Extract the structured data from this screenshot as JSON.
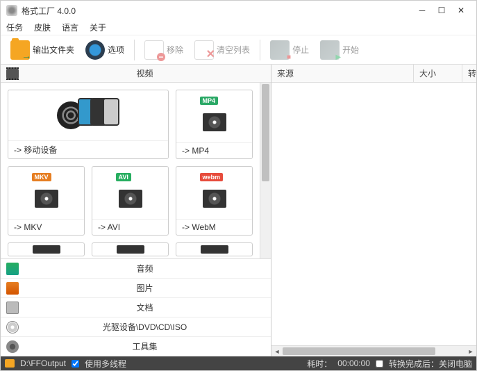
{
  "window": {
    "title": "格式工厂 4.0.0"
  },
  "menu": {
    "tasks": "任务",
    "skin": "皮肤",
    "language": "语言",
    "about": "关于"
  },
  "toolbar": {
    "output_folder": "输出文件夹",
    "options": "选项",
    "remove": "移除",
    "clear_list": "清空列表",
    "stop": "停止",
    "start": "开始"
  },
  "categories": {
    "video": "视频",
    "audio": "音频",
    "picture": "图片",
    "document": "文档",
    "disc": "光驱设备\\DVD\\CD\\ISO",
    "toolkit": "工具集"
  },
  "tiles": {
    "mobile": "-> 移动设备",
    "mp4": "-> MP4",
    "mkv": "-> MKV",
    "avi": "-> AVI",
    "webm": "-> WebM"
  },
  "badges": {
    "mp4": "MP4",
    "mkv": "MKV",
    "avi": "AVI",
    "webm": "webm"
  },
  "list": {
    "source": "来源",
    "size": "大小",
    "status": "转"
  },
  "status": {
    "output_path": "D:\\FFOutput",
    "multithread": "使用多线程",
    "elapsed_label": "耗时：",
    "elapsed_value": "00:00:00",
    "after_convert": "转换完成后：关闭电脑"
  }
}
